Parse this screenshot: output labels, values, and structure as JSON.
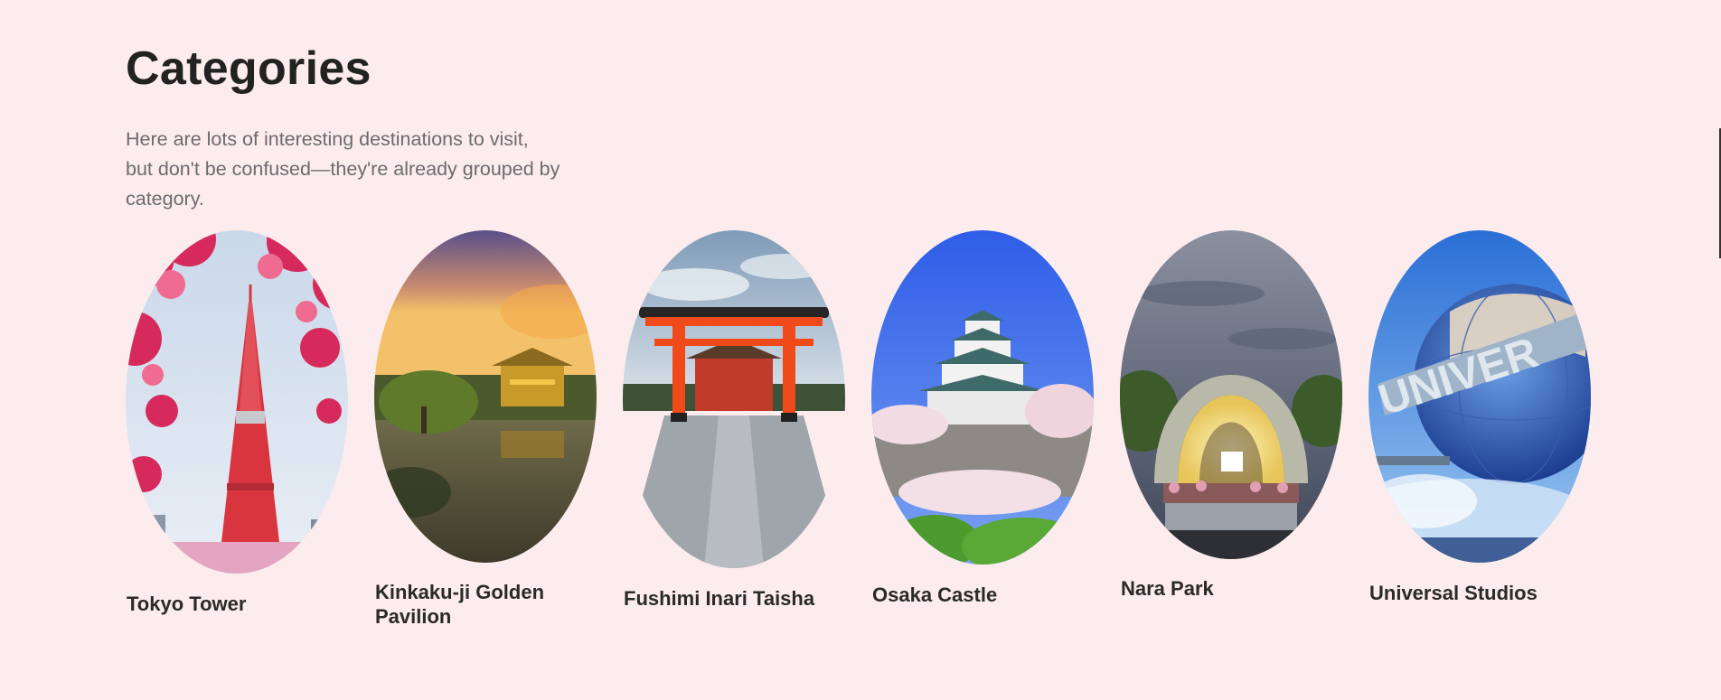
{
  "section": {
    "title": "Categories",
    "description_lines": [
      "Here are lots of interesting destinations to visit,",
      "but don't be confused—they're already grouped by",
      "category."
    ]
  },
  "categories": [
    {
      "label": "Tokyo Tower",
      "image": "tokyo-tower-cherry-blossom"
    },
    {
      "label": "Kinkaku-ji Golden Pavilion",
      "image": "golden-pavilion-pond-sunset"
    },
    {
      "label": "Fushimi Inari Taisha",
      "image": "torii-gate-stone-path"
    },
    {
      "label": "Osaka Castle",
      "image": "osaka-castle-blue-sky"
    },
    {
      "label": "Nara Park",
      "image": "arch-memorial-night"
    },
    {
      "label": "Universal Studios",
      "image": "universal-globe"
    }
  ]
}
